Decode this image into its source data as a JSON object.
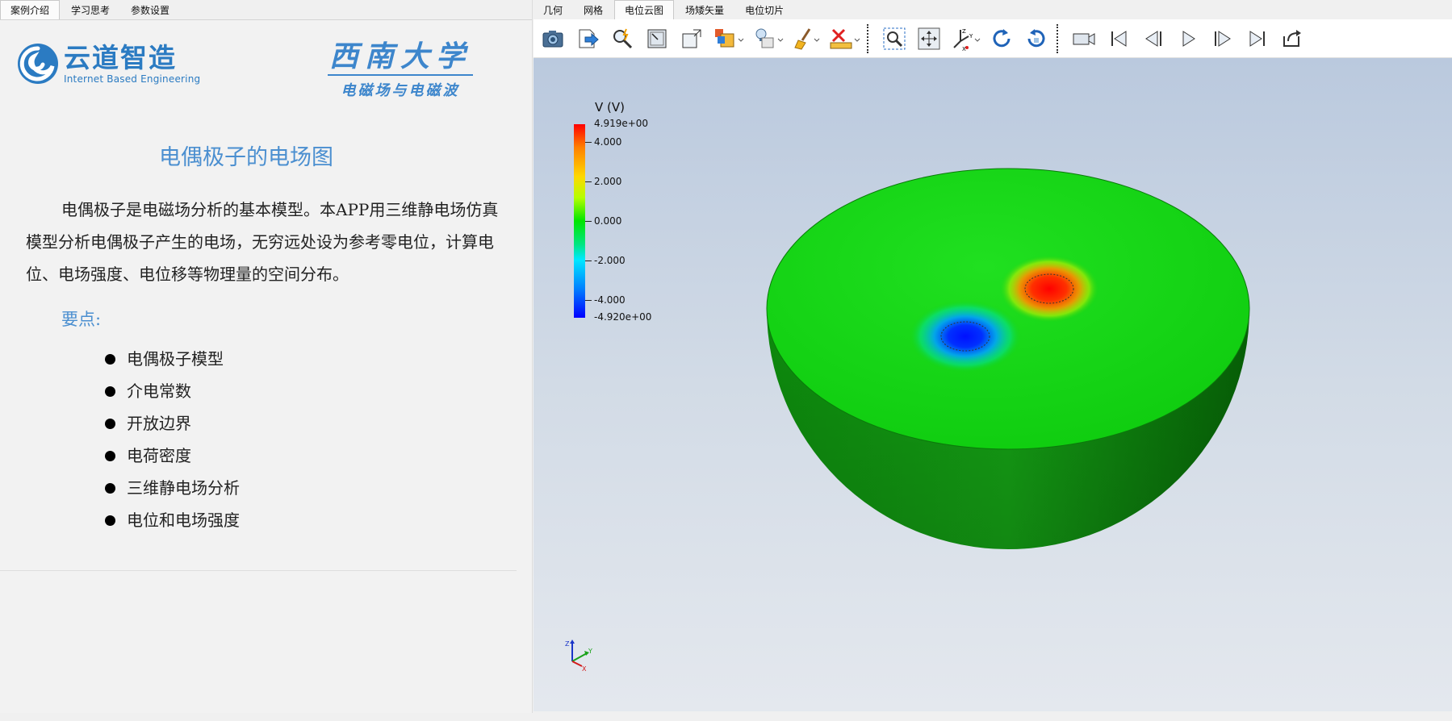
{
  "left_tabs": [
    "案例介绍",
    "学习思考",
    "参数设置"
  ],
  "right_tabs": [
    "几何",
    "网格",
    "电位云图",
    "场矮矢量",
    "电位切片"
  ],
  "logos": {
    "yundao_main": "云道智造",
    "yundao_sub": "Internet Based Engineering",
    "swu_main": "西南大学",
    "swu_sub": "电磁场与电磁波"
  },
  "title": "电偶极子的电场图",
  "intro": "电偶极子是电磁场分析的基本模型。本APP用三维静电场仿真模型分析电偶极子产生的电场，无穷远处设为参考零电位，计算电位、电场强度、电位移等物理量的空间分布。",
  "points_label": "要点:",
  "points": [
    "电偶极子模型",
    "介电常数",
    "开放边界",
    "电荷密度",
    "三维静电场分析",
    "电位和电场强度"
  ],
  "toolbar_icons": [
    "camera-icon",
    "export-icon",
    "probe-icon",
    "fit-box-icon",
    "box-select-icon",
    "clip-box-icon",
    "light-icon",
    "brush-icon",
    "ruler-delete-icon",
    "zoom-box-icon",
    "pan-icon",
    "axes-orient-icon",
    "rotate-cw-icon",
    "rotate-ccw-icon",
    "video-camera-icon",
    "first-frame-icon",
    "prev-frame-icon",
    "play-icon",
    "next-frame-icon",
    "last-frame-icon",
    "loop-icon"
  ],
  "colorbar": {
    "title": "V (V)",
    "max_label": "4.919e+00",
    "min_label": "-4.920e+00",
    "ticks": [
      "4.000",
      "2.000",
      "0.000",
      "-2.000",
      "-4.000"
    ],
    "max": 4.919,
    "min": -4.92,
    "tick_values": [
      4,
      2,
      0,
      -2,
      -4
    ]
  },
  "axes_triad": {
    "x_label": "X",
    "y_label": "Y",
    "z_label": "Z"
  },
  "colors": {
    "accent_blue": "#4b8fd0",
    "field_green": "#12d012",
    "positive_pole": "#ff2000",
    "negative_pole": "#0010ff"
  }
}
